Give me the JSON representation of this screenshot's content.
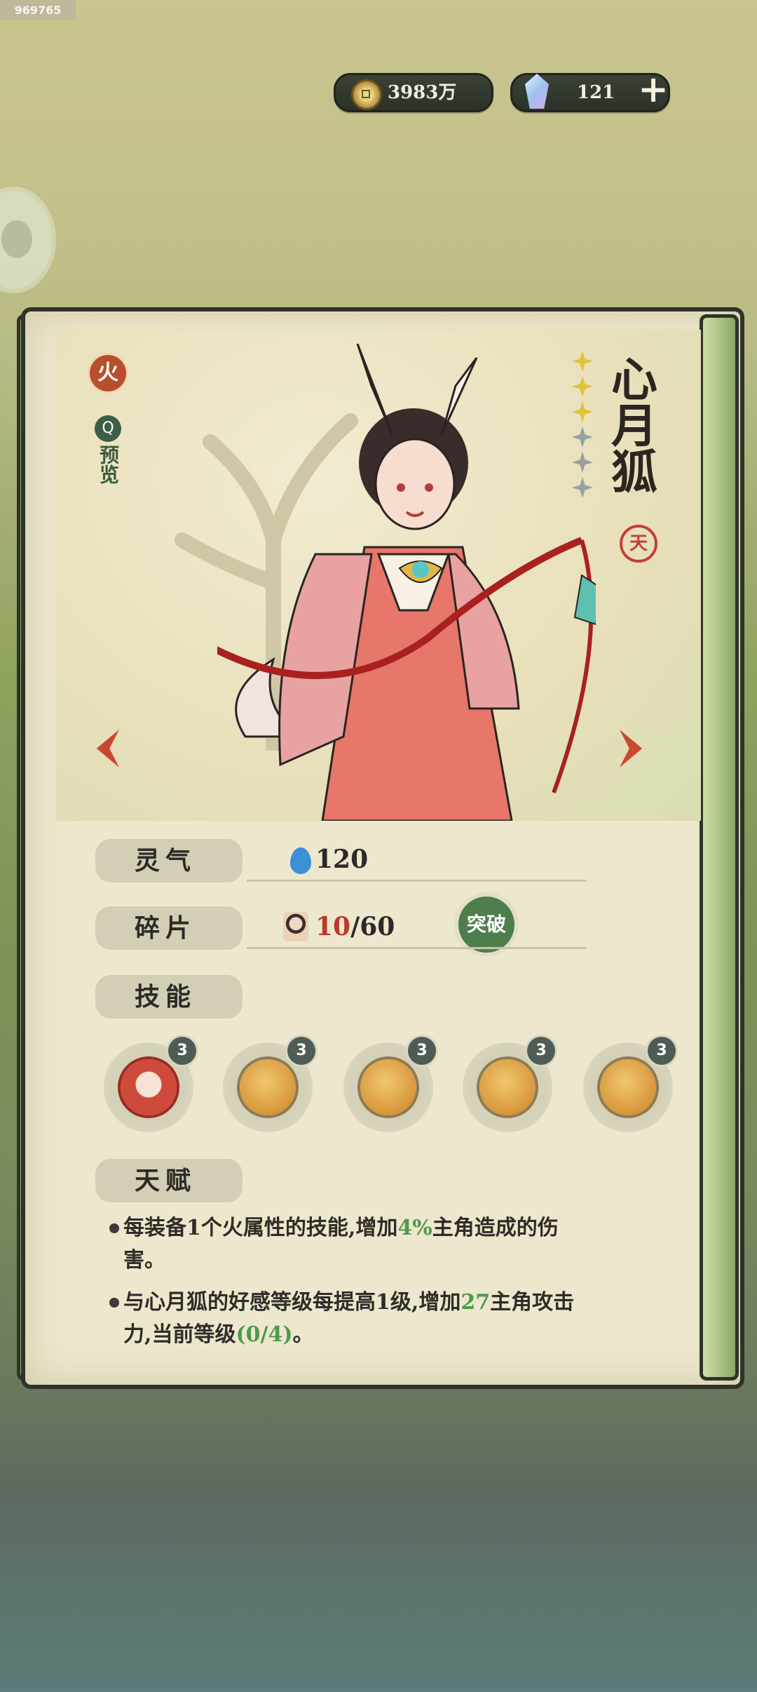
{
  "watermark": "969765",
  "currency": {
    "coins": "3983万",
    "gems": "121",
    "add_label": "+"
  },
  "hero": {
    "element": "火",
    "preview_icon": "Q",
    "preview_label": "预览",
    "name": "心月狐",
    "rank_seal": "天",
    "stars_total": 6,
    "stars_filled": 3
  },
  "stats": {
    "aura_label": "灵气",
    "aura_value": "120",
    "fragment_label": "碎片",
    "fragment_current": "10",
    "fragment_total": "/60",
    "breakthrough_label": "突破",
    "skills_label": "技能"
  },
  "skills": [
    {
      "name": "skill-1",
      "level": "3"
    },
    {
      "name": "skill-2",
      "level": "3"
    },
    {
      "name": "skill-3",
      "level": "3"
    },
    {
      "name": "skill-4",
      "level": "3"
    },
    {
      "name": "skill-5",
      "level": "3"
    }
  ],
  "talent": {
    "label": "天赋",
    "line1_a": "每装备1个火属性的技能,增加",
    "line1_hl": "4%",
    "line1_b": "主角造成的伤害。",
    "line2_a": "与心月狐的好感等级每提高1级,增加",
    "line2_hl": "27",
    "line2_b": "主角攻击力,当前等级",
    "line2_hl2": "(0/4)",
    "line2_c": "。"
  },
  "colors": {
    "accent_red": "#b93a2a",
    "accent_green": "#4e9a4a",
    "star_gold": "#e3c13a"
  }
}
